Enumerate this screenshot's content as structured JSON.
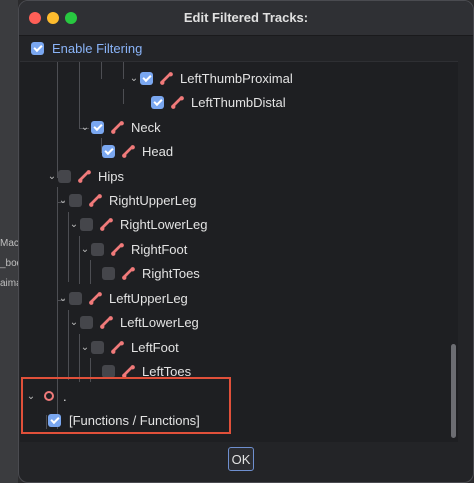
{
  "dialog": {
    "title": "Edit Filtered Tracks:",
    "enable_filtering": {
      "label": "Enable Filtering",
      "checked": true
    },
    "ok_label": "OK"
  },
  "tree": {
    "rows": [
      {
        "label": "LeftThumbProximal",
        "checked": true,
        "expanded": true,
        "icon": "bone-icon"
      },
      {
        "label": "LeftThumbDistal",
        "checked": true,
        "expanded": null,
        "icon": "bone-icon"
      },
      {
        "label": "Neck",
        "checked": true,
        "expanded": true,
        "icon": "bone-icon"
      },
      {
        "label": "Head",
        "checked": true,
        "expanded": null,
        "icon": "bone-icon"
      },
      {
        "label": "Hips",
        "checked": false,
        "expanded": true,
        "icon": "bone-icon"
      },
      {
        "label": "RightUpperLeg",
        "checked": false,
        "expanded": true,
        "icon": "bone-icon"
      },
      {
        "label": "RightLowerLeg",
        "checked": false,
        "expanded": true,
        "icon": "bone-icon"
      },
      {
        "label": "RightFoot",
        "checked": false,
        "expanded": true,
        "icon": "bone-icon"
      },
      {
        "label": "RightToes",
        "checked": false,
        "expanded": null,
        "icon": "bone-icon"
      },
      {
        "label": "LeftUpperLeg",
        "checked": false,
        "expanded": true,
        "icon": "bone-icon"
      },
      {
        "label": "LeftLowerLeg",
        "checked": false,
        "expanded": true,
        "icon": "bone-icon"
      },
      {
        "label": "LeftFoot",
        "checked": false,
        "expanded": true,
        "icon": "bone-icon"
      },
      {
        "label": "LeftToes",
        "checked": false,
        "expanded": null,
        "icon": "bone-icon"
      },
      {
        "label": ".",
        "checked": null,
        "expanded": true,
        "icon": "node-circle-icon"
      },
      {
        "label": "[Functions / Functions]",
        "checked": true,
        "expanded": null,
        "icon": null
      }
    ]
  },
  "background": {
    "labels": [
      "Mach",
      "_bod",
      "aima"
    ]
  },
  "colors": {
    "accent": "#7aa7f0",
    "link": "#8ab4f8",
    "bone": "#f07a7a",
    "highlight": "#e0503a",
    "traffic_close": "#ff5f57",
    "traffic_min": "#febc2e",
    "traffic_max": "#28c840"
  }
}
